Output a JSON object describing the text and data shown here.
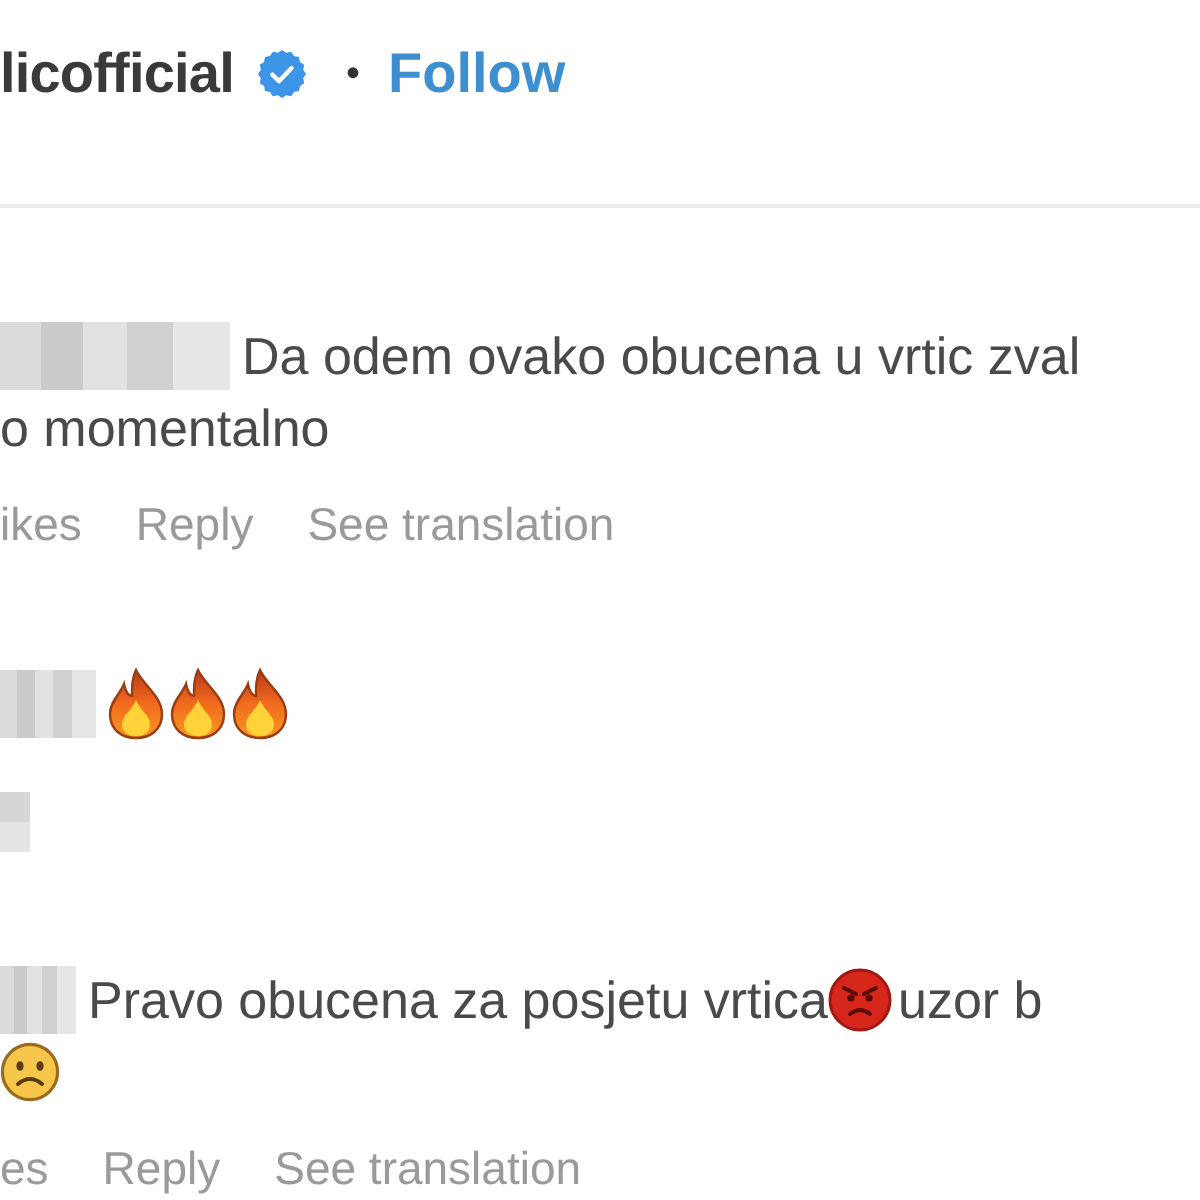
{
  "post_header": {
    "username": "licofficial",
    "verified": true,
    "separator": "•",
    "follow_label": "Follow"
  },
  "comments": [
    {
      "author_blurred": true,
      "lines": [
        [
          {
            "kind": "text",
            "text": "Da odem ovako obucena u vrtic zval"
          }
        ],
        [
          {
            "kind": "text",
            "text": "o momentalno"
          }
        ]
      ],
      "actions": [
        "ikes",
        "Reply",
        "See translation"
      ]
    },
    {
      "author_blurred": true,
      "lines": [
        [
          {
            "kind": "fire"
          },
          {
            "kind": "fire"
          },
          {
            "kind": "fire"
          }
        ]
      ],
      "actions_blurred": true
    },
    {
      "author_blurred": true,
      "lines": [
        [
          {
            "kind": "text",
            "text": "Pravo obucena za posjetu vrtica"
          },
          {
            "kind": "angry"
          },
          {
            "kind": "text",
            "text": "uzor b"
          }
        ],
        [
          {
            "kind": "frown"
          }
        ]
      ],
      "actions": [
        "es",
        "Reply",
        "See translation"
      ]
    }
  ]
}
